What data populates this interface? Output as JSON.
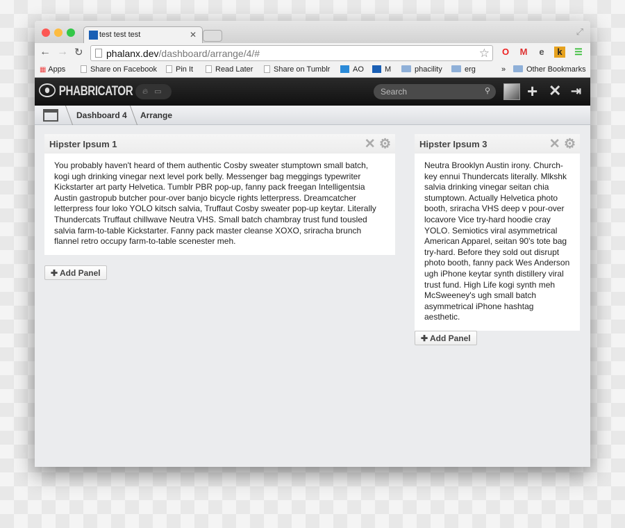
{
  "browser": {
    "tab_title": "test test test",
    "url_host": "phalanx.dev",
    "url_path": "/dashboard/arrange/4/#",
    "bookmarks": [
      "Apps",
      "Share on Facebook",
      "Pin It",
      "Read Later",
      "Share on Tumblr",
      "AO",
      "M",
      "phacility",
      "erg",
      "Other Bookmarks"
    ],
    "overflow": "»"
  },
  "header": {
    "logo": "PHABRICATOR",
    "search_placeholder": "Search"
  },
  "breadcrumbs": [
    "Dashboard 4",
    "Arrange"
  ],
  "panels": [
    {
      "title": "Hipster Ipsum 1",
      "body": "You probably haven't heard of them authentic Cosby sweater stumptown small batch, kogi ugh drinking vinegar next level pork belly. Messenger bag meggings typewriter Kickstarter art party Helvetica. Tumblr PBR pop-up, fanny pack freegan Intelligentsia Austin gastropub butcher pour-over banjo bicycle rights letterpress. Dreamcatcher letterpress four loko YOLO kitsch salvia, Truffaut Cosby sweater pop-up keytar. Literally Thundercats Truffaut chillwave Neutra VHS. Small batch chambray trust fund tousled salvia farm-to-table Kickstarter. Fanny pack master cleanse XOXO, sriracha brunch flannel retro occupy farm-to-table scenester meh."
    },
    {
      "title": "Hipster Ipsum 3",
      "body": "Neutra Brooklyn Austin irony. Church-key ennui Thundercats literally. Mlkshk salvia drinking vinegar seitan chia stumptown. Actually Helvetica photo booth, sriracha VHS deep v pour-over locavore Vice try-hard hoodie cray YOLO. Semiotics viral asymmetrical American Apparel, seitan 90's tote bag try-hard. Before they sold out disrupt photo booth, fanny pack Wes Anderson ugh iPhone keytar synth distillery viral trust fund. High Life kogi synth meh McSweeney's ugh small batch asymmetrical iPhone hashtag aesthetic."
    }
  ],
  "add_panel_label": "Add Panel",
  "colors": {
    "close": "#fc5753",
    "minimize": "#fdbc40",
    "zoom": "#33c748",
    "content_bg": "#ebecee"
  }
}
